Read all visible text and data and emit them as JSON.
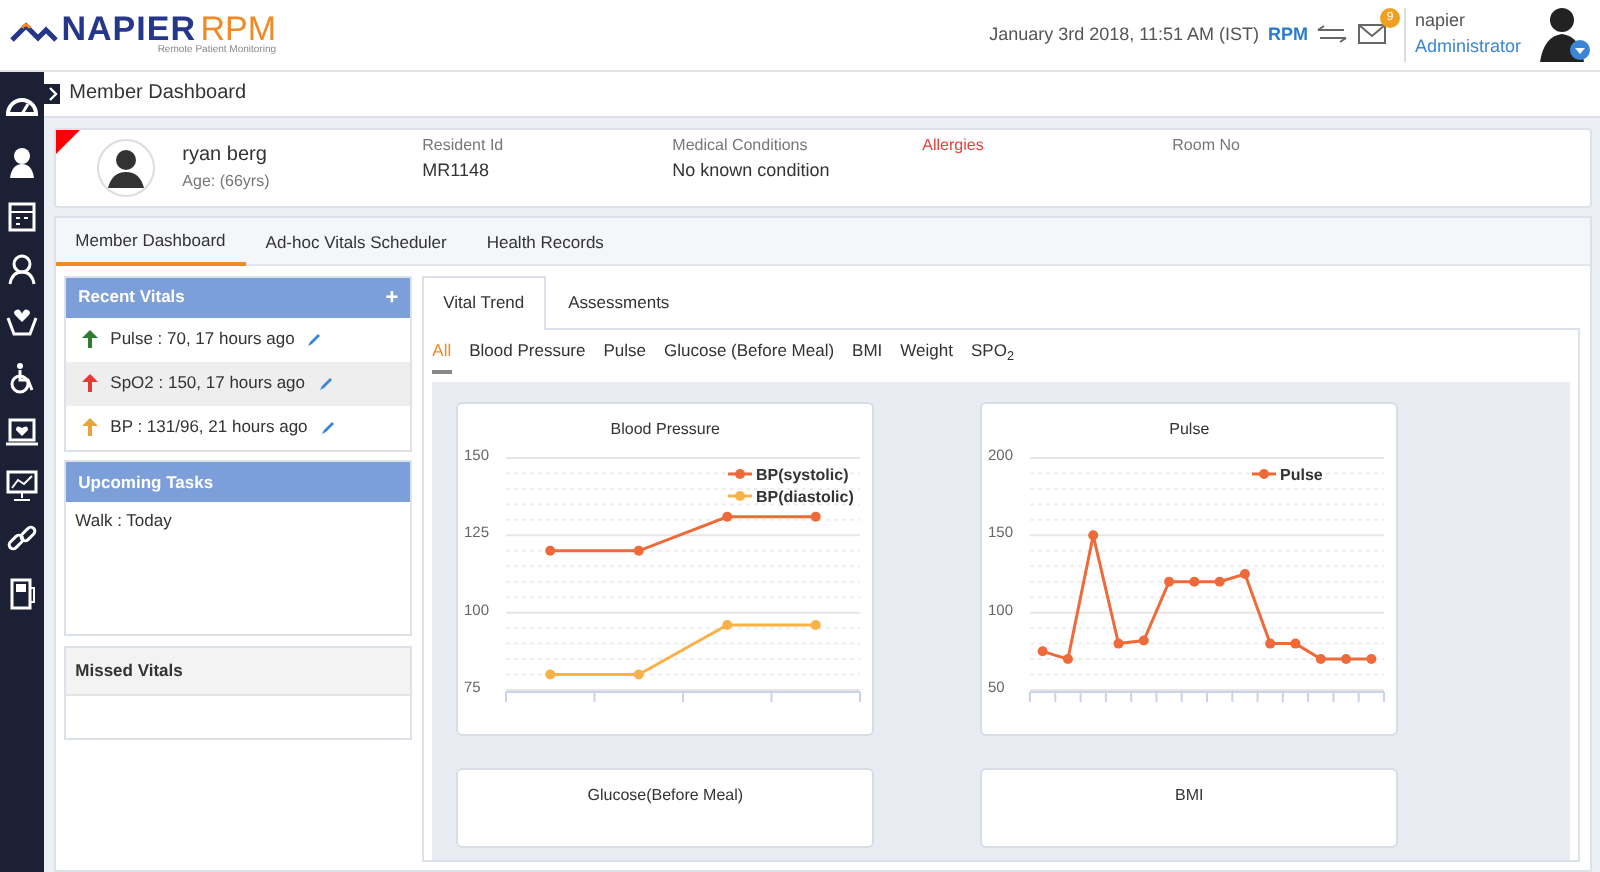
{
  "header": {
    "brand": "NAPIER",
    "brand_suffix": "RPM",
    "tagline": "Remote Patient Monitoring",
    "datetime": "January 3rd 2018, 11:51 AM (IST)",
    "app": "RPM",
    "mail_count": "9",
    "user_name": "napier",
    "user_role": "Administrator"
  },
  "page_title": "Member Dashboard",
  "patient": {
    "name": "ryan berg",
    "age": "Age: (66yrs)",
    "fields": [
      {
        "label": "Resident Id",
        "value": "MR1148",
        "kind": "normal"
      },
      {
        "label": "Medical Conditions",
        "value": "No known condition",
        "kind": "normal"
      },
      {
        "label": "Allergies",
        "kind": "alert"
      },
      {
        "label": "Room No",
        "kind": "normal"
      }
    ]
  },
  "tabs": [
    {
      "label": "Member Dashboard",
      "selected": true
    },
    {
      "label": "Ad-hoc Vitals Scheduler",
      "selected": false
    },
    {
      "label": "Health Records",
      "selected": false
    }
  ],
  "recent_vitals": {
    "title": "Recent Vitals",
    "add": "+",
    "items": [
      {
        "text": "Pulse : 70, 17 hours ago",
        "color": "#2e7d32",
        "selected": false
      },
      {
        "text": "SpO2 : 150, 17 hours ago",
        "color": "#e53935",
        "selected": true
      },
      {
        "text": "BP : 131/96, 21 hours ago",
        "color": "#e8a33d",
        "selected": false
      }
    ]
  },
  "upcoming_tasks": {
    "title": "Upcoming Tasks",
    "items": [
      "Walk : Today"
    ]
  },
  "missed_vitals": {
    "title": "Missed Vitals"
  },
  "vital_tabs": [
    {
      "label": "Vital Trend",
      "selected": true
    },
    {
      "label": "Assessments",
      "selected": false
    }
  ],
  "filters": [
    {
      "label": "All",
      "selected": true
    },
    {
      "label": "Blood Pressure",
      "selected": false
    },
    {
      "label": "Pulse",
      "selected": false
    },
    {
      "label": "Glucose (Before Meal)",
      "selected": false
    },
    {
      "label": "BMI",
      "selected": false
    },
    {
      "label": "Weight",
      "selected": false
    },
    {
      "label": "SPO$_{2}$",
      "selected": false
    }
  ],
  "charts": [
    {
      "chart_data": {
        "type": "line",
        "title": "Blood Pressure",
        "legend": "top-right",
        "ylim": [
          75,
          150
        ],
        "yticks": [
          75,
          100,
          125,
          150
        ],
        "series": [
          {
            "name": "BP(systolic)",
            "color": "#ef6a3a",
            "marker": "circle",
            "values": [
              120,
              120,
              131,
              131
            ]
          },
          {
            "name": "BP(diastolic)",
            "color": "#f9b248",
            "marker": "circle",
            "values": [
              80,
              80,
              96,
              96
            ]
          }
        ]
      }
    },
    {
      "chart_data": {
        "type": "line",
        "title": "Pulse",
        "legend": "top-right",
        "ylim": [
          50,
          200
        ],
        "yticks": [
          50,
          100,
          150,
          200
        ],
        "series": [
          {
            "name": "Pulse",
            "color": "#ef6a3a",
            "marker": "circle",
            "values": [
              75,
              70,
              150,
              80,
              82,
              120,
              120,
              120,
              125,
              80,
              80,
              70,
              70,
              70
            ]
          }
        ]
      }
    },
    {
      "title": "Glucose(Before Meal)"
    },
    {
      "title": "BMI"
    }
  ]
}
